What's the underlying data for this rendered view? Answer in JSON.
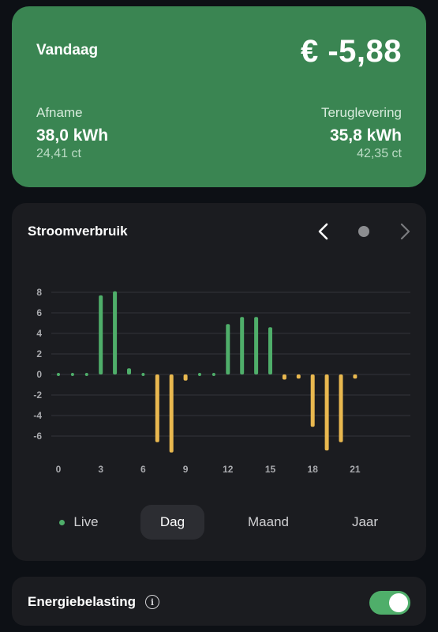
{
  "summary": {
    "title": "Vandaag",
    "total": "€ -5,88",
    "afname_label": "Afname",
    "afname_value": "38,0 kWh",
    "afname_price": "24,41 ct",
    "terug_label": "Teruglevering",
    "terug_value": "35,8 kWh",
    "terug_price": "42,35 ct"
  },
  "chart_card": {
    "title": "Stroomverbruik",
    "prev_icon": "chevron-left-icon",
    "current_icon": "dot-icon",
    "next_icon": "chevron-right-icon"
  },
  "chart_data": {
    "type": "bar",
    "x": [
      0,
      1,
      2,
      3,
      4,
      5,
      6,
      7,
      8,
      9,
      10,
      11,
      12,
      13,
      14,
      15,
      16,
      17,
      18,
      19,
      20,
      21
    ],
    "values": [
      0.1,
      0.1,
      0.1,
      7.7,
      8.1,
      0.6,
      0.1,
      -6.6,
      -7.6,
      -0.6,
      0.1,
      0.1,
      4.9,
      5.6,
      5.6,
      4.6,
      -0.5,
      -0.4,
      -5.1,
      -7.4,
      -6.6,
      -0.4
    ],
    "xticks": [
      "0",
      "3",
      "6",
      "9",
      "12",
      "15",
      "18",
      "21"
    ],
    "yticks": [
      "8",
      "6",
      "4",
      "2",
      "0",
      "-2",
      "-4",
      "-6"
    ],
    "ylim": [
      -8,
      8
    ],
    "grid": true,
    "positive_color": "#4fae6a",
    "negative_color": "#e9b84f"
  },
  "tabs": [
    "Live",
    "Dag",
    "Maand",
    "Jaar"
  ],
  "active_tab": "Dag",
  "tax": {
    "label": "Energiebelasting",
    "info_icon": "info-icon",
    "enabled": true
  },
  "colors": {
    "background": "#0d1015",
    "summary_card": "#3a8552",
    "card": "#1b1c20",
    "accent": "#4fae6a"
  }
}
